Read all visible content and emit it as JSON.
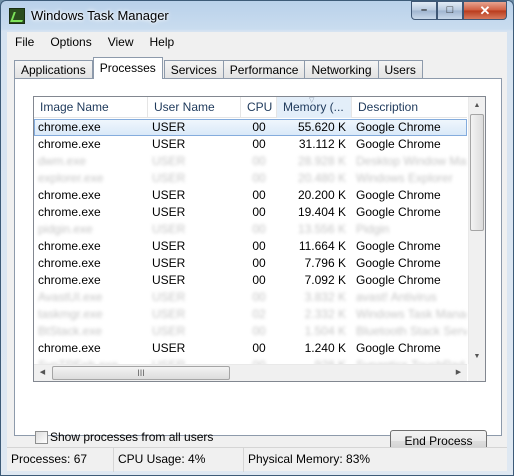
{
  "window": {
    "title": "Windows Task Manager"
  },
  "menu": [
    "File",
    "Options",
    "View",
    "Help"
  ],
  "tabs": [
    "Applications",
    "Processes",
    "Services",
    "Performance",
    "Networking",
    "Users"
  ],
  "active_tab": "Processes",
  "columns": {
    "image_name": "Image Name",
    "user_name": "User Name",
    "cpu": "CPU",
    "memory": "Memory (...",
    "description": "Description"
  },
  "processes": [
    {
      "name": "chrome.exe",
      "user": "USER",
      "cpu": "00",
      "memory": "55.620 K",
      "desc": "Google Chrome",
      "selected": true
    },
    {
      "name": "chrome.exe",
      "user": "USER",
      "cpu": "00",
      "memory": "31.112 K",
      "desc": "Google Chrome"
    },
    {
      "name": "dwm.exe",
      "user": "USER",
      "cpu": "00",
      "memory": "28.928 K",
      "desc": "Desktop Window Mana",
      "blurred": true
    },
    {
      "name": "explorer.exe",
      "user": "USER",
      "cpu": "00",
      "memory": "20.480 K",
      "desc": "Windows Explorer",
      "blurred": true
    },
    {
      "name": "chrome.exe",
      "user": "USER",
      "cpu": "00",
      "memory": "20.200 K",
      "desc": "Google Chrome"
    },
    {
      "name": "chrome.exe",
      "user": "USER",
      "cpu": "00",
      "memory": "19.404 K",
      "desc": "Google Chrome"
    },
    {
      "name": "pidgin.exe",
      "user": "USER",
      "cpu": "00",
      "memory": "13.556 K",
      "desc": "Pidgin",
      "blurred": true
    },
    {
      "name": "chrome.exe",
      "user": "USER",
      "cpu": "00",
      "memory": "11.664 K",
      "desc": "Google Chrome"
    },
    {
      "name": "chrome.exe",
      "user": "USER",
      "cpu": "00",
      "memory": "7.796 K",
      "desc": "Google Chrome"
    },
    {
      "name": "chrome.exe",
      "user": "USER",
      "cpu": "00",
      "memory": "7.092 K",
      "desc": "Google Chrome"
    },
    {
      "name": "AvastUI.exe",
      "user": "USER",
      "cpu": "00",
      "memory": "3.832 K",
      "desc": "avast! Antivirus",
      "blurred": true
    },
    {
      "name": "taskmgr.exe",
      "user": "USER",
      "cpu": "02",
      "memory": "2.332 K",
      "desc": "Windows Task Manage",
      "blurred": true
    },
    {
      "name": "BtStack.exe",
      "user": "USER",
      "cpu": "00",
      "memory": "1.504 K",
      "desc": "Bluetooth Stack Serve",
      "blurred": true
    },
    {
      "name": "chrome.exe",
      "user": "USER",
      "cpu": "00",
      "memory": "1.240 K",
      "desc": "Google Chrome"
    },
    {
      "name": "SynTPEnh.exe",
      "user": "USER",
      "cpu": "00",
      "memory": "928 K",
      "desc": "Synaptics TouchPad En",
      "blurred": true
    }
  ],
  "show_all_label": "Show processes from all users",
  "end_process_label": "End Process",
  "status": {
    "processes": "Processes: 67",
    "cpu": "CPU Usage: 4%",
    "memory": "Physical Memory: 83%"
  },
  "hscroll_grip": "III"
}
